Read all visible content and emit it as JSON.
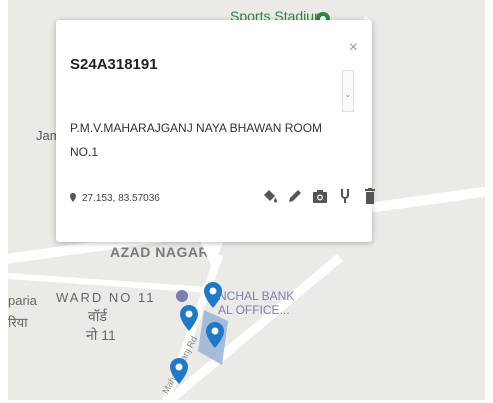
{
  "map": {
    "labels": {
      "stadium": "Sports Stadium",
      "jam": "Jam",
      "azad_nagar": "AZAD NAGAR",
      "ward": "WARD NO 11",
      "paria": "paria",
      "riya": "रिया",
      "ward_hi_line1": "वॉर्ड",
      "ward_hi_line2": "नो 11",
      "bank_line1": "NCHAL BANK",
      "bank_line2": "AL OFFICE...",
      "road": "Maharajganj Rd"
    },
    "colors": {
      "background": "#eceae6",
      "pin": "#1e7ac8",
      "park": "#2a8a3e",
      "poi": "#7b7db4"
    }
  },
  "popup": {
    "title": "S24A318191",
    "address": "P.M.V.MAHARAJGANJ NAYA BHAWAN ROOM NO.1",
    "coordinates": "27.153, 83.57036",
    "close": "×",
    "scroll_arrow": "⌄",
    "actions": [
      "paint-bucket-icon",
      "pencil-icon",
      "camera-icon",
      "tuning-fork-icon",
      "trash-icon"
    ]
  }
}
